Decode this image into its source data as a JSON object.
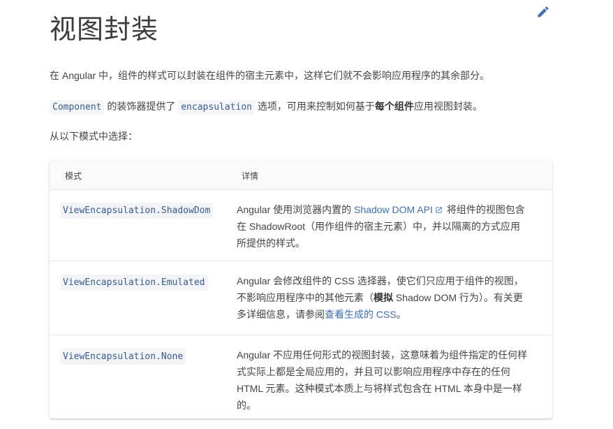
{
  "title": "视图封装",
  "intro": "在 Angular 中，组件的样式可以封装在组件的宿主元素中，这样它们就不会影响应用程序的其余部分。",
  "decorator_line": {
    "code1": "Component",
    "text1": " 的装饰器提供了 ",
    "code2": "encapsulation",
    "text2": " 选项，可用来控制如何基于",
    "bold": "每个组件",
    "text3": "应用视图封装。"
  },
  "choose_text": "从以下模式中选择：",
  "table": {
    "headers": {
      "mode": "模式",
      "details": "详情"
    },
    "rows": [
      {
        "mode": "ViewEncapsulation.ShadowDom",
        "line1_pre": "Angular 使用浏览器内置的 ",
        "line1_link": "Shadow DOM API",
        "line1_post": " 将组件的视图包含",
        "line2": "在 ShadowRoot（用作组件的宿主元素）中，并以隔离的方式应用",
        "line3": "所提供的样式。"
      },
      {
        "mode": "ViewEncapsulation.Emulated",
        "line1": "Angular 会修改组件的 CSS 选择器，使它们只应用于组件的视图，",
        "line2_pre": "不影响应用程序中的其他元素（",
        "line2_bold": "模拟",
        "line2_post": " Shadow DOM 行为）。有关更",
        "line3_pre": "多详细信息，请参阅",
        "line3_link": "查看生成的 CSS",
        "line3_post": "。"
      },
      {
        "mode": "ViewEncapsulation.None",
        "line1": "Angular 不应用任何形式的视图封装，这意味着为组件指定的任何样",
        "line2": "式实际上都是全局应用的，并且可以影响应用程序中存在的任何",
        "line3": "HTML 元素。这种模式本质上与将样式包含在 HTML 本身中是一样",
        "line4": "的。"
      }
    ]
  },
  "icons": {
    "edit": "pencil-icon",
    "external": "external-link-icon"
  },
  "colors": {
    "link": "#3c6fb4",
    "code_text": "#3a5a8c",
    "edit_icon": "#3c6fb4"
  }
}
